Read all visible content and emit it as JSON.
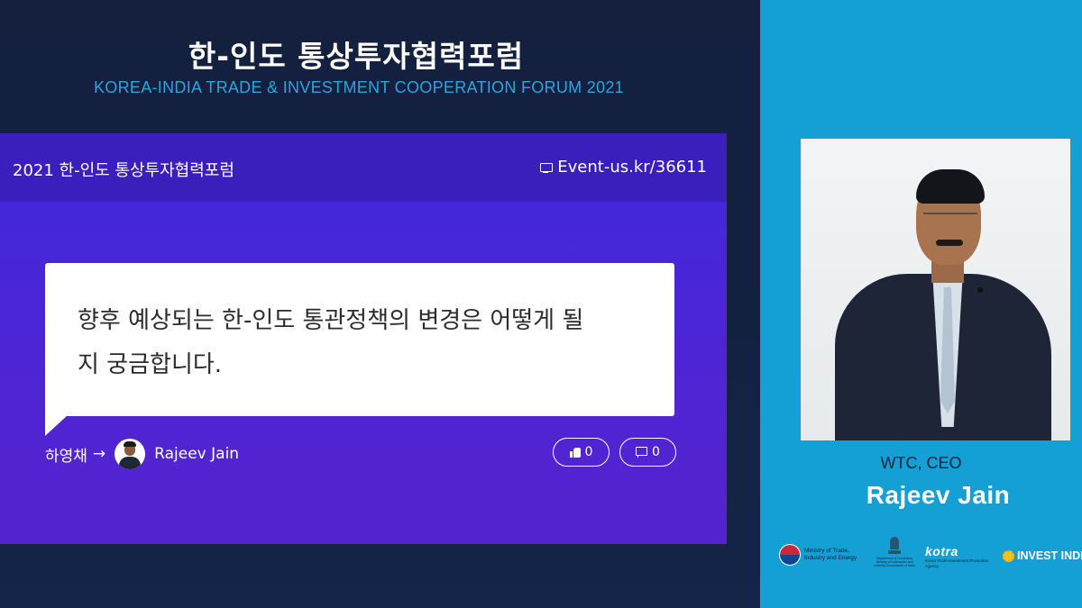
{
  "forum": {
    "title_ko": "한-인도 통상투자협력포럼",
    "title_en": "KOREA-INDIA TRADE & INVESTMENT COOPERATION FORUM 2021"
  },
  "slido": {
    "event_name": "2021 한-인도 통상투자협력포럼",
    "event_code": "Event-us.kr/36611",
    "question": {
      "line1": "향후 예상되는 한-인도 통관정책의 변경은 어떻게 될",
      "line2": "지 궁금합니다.",
      "author": "하영채",
      "arrow": "→",
      "recipient": "Rajeev Jain",
      "likes": "0",
      "comments": "0"
    }
  },
  "speaker": {
    "role": "WTC, CEO",
    "name": "Rajeev Jain"
  },
  "logos": {
    "motie": "Ministry of Trade, Industry and Energy",
    "india": "Department of Commerce Ministry of Commerce and Industry Government of India",
    "kotra": "kotra",
    "kotra_sub": "Korea Trade-Investment Promotion Agency",
    "invest_india": "INVEST INDIA"
  },
  "colors": {
    "background": "#121d3a",
    "right_panel": "#14a0d4",
    "slido_purple": "#4a26d6",
    "subtitle_blue": "#2ea3e0"
  }
}
